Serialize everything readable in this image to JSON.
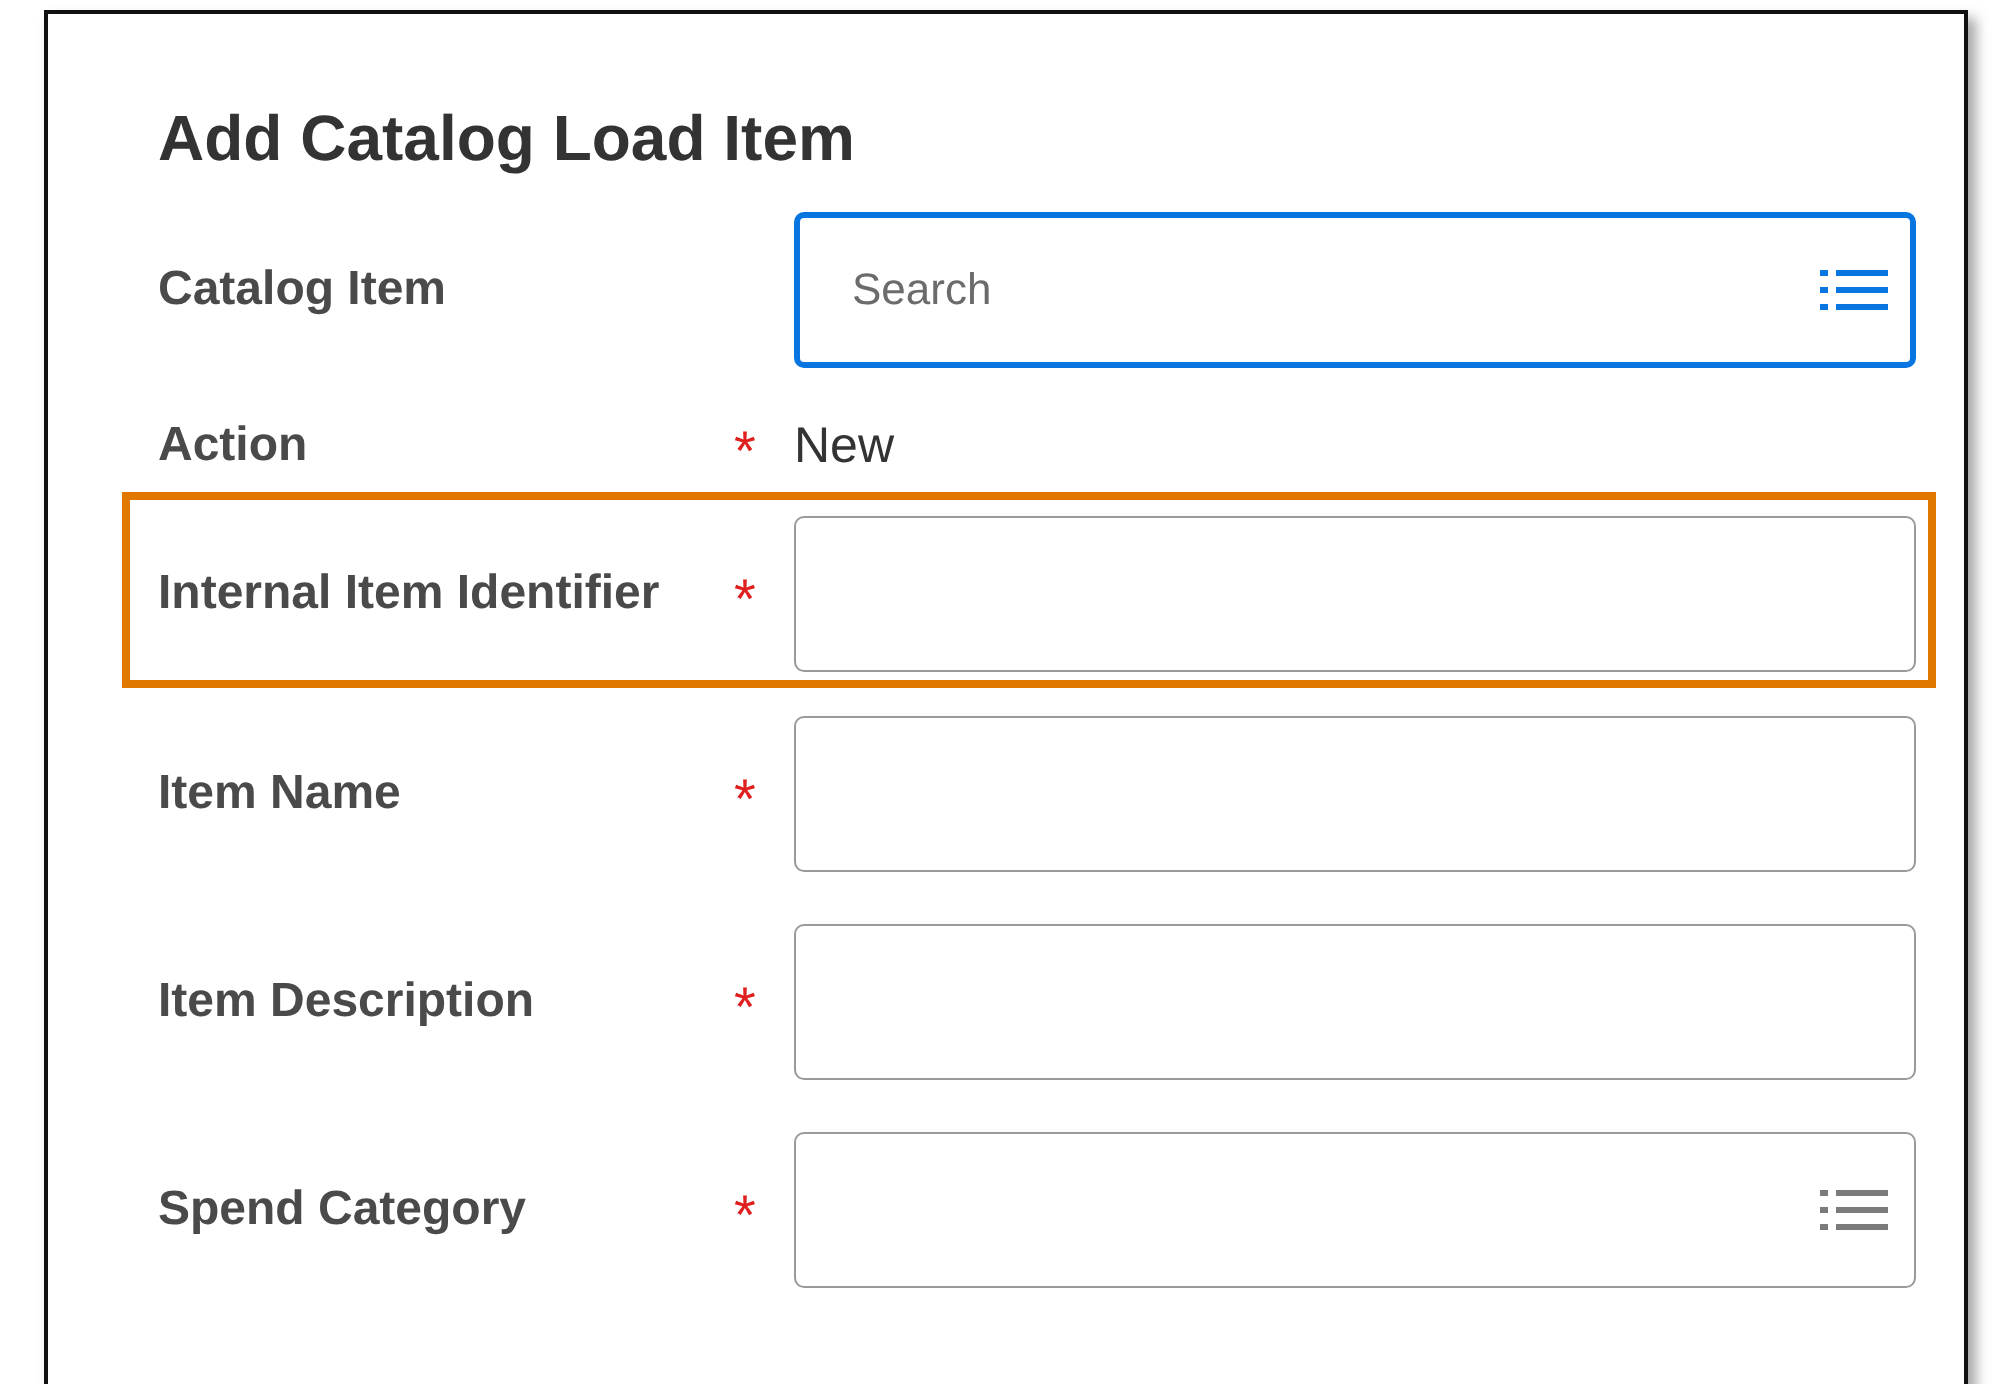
{
  "title": "Add Catalog Load Item",
  "fields": [
    {
      "label": "Catalog Item",
      "kind": "prompt",
      "required": false,
      "placeholder": "Search",
      "focused": true,
      "highlighted": false
    },
    {
      "label": "Action",
      "kind": "static",
      "required": true,
      "value": "New",
      "highlighted": false
    },
    {
      "label": "Internal Item Identifier",
      "kind": "text",
      "required": true,
      "focused": false,
      "highlighted": true
    },
    {
      "label": "Item Name",
      "kind": "text",
      "required": true,
      "focused": false,
      "highlighted": false
    },
    {
      "label": "Item Description",
      "kind": "text",
      "required": true,
      "focused": false,
      "highlighted": false
    },
    {
      "label": "Spend Category",
      "kind": "prompt",
      "required": true,
      "focused": false,
      "highlighted": false
    }
  ],
  "required_mark": "*"
}
